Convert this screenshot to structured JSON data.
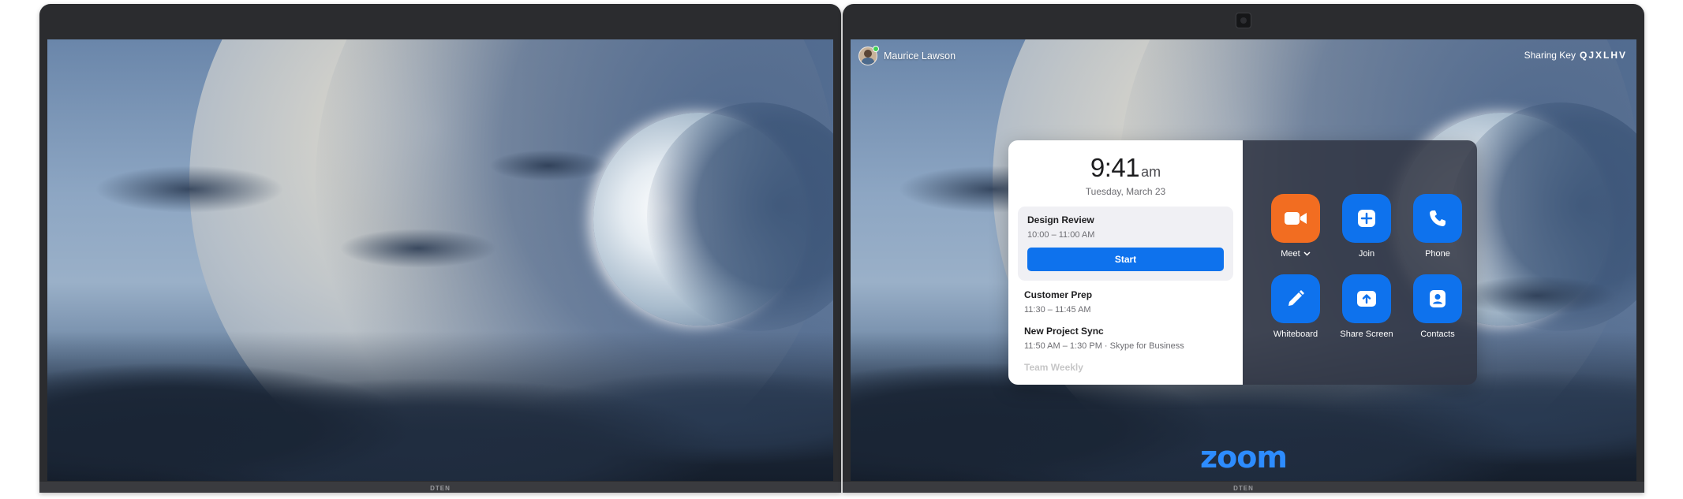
{
  "left_display": {
    "brand": "DTEN"
  },
  "right_display": {
    "brand": "DTEN",
    "user": {
      "name": "Maurice Lawson",
      "status_color": "#3fcf55"
    },
    "sharing": {
      "label": "Sharing Key",
      "key": "QJXLHV"
    },
    "clock": {
      "time": "9:41",
      "ampm": "am",
      "date": "Tuesday, March 23"
    },
    "meetings": [
      {
        "title": "Design Review",
        "time": "10:00 – 11:00 AM",
        "action": "Start"
      },
      {
        "title": "Customer Prep",
        "time": "11:30 – 11:45 AM"
      },
      {
        "title": "New Project Sync",
        "time": "11:50 AM – 1:30 PM · Skype for Business"
      },
      {
        "title": "Team Weekly"
      }
    ],
    "actions": [
      {
        "label": "Meet",
        "icon": "video-camera-icon",
        "color": "#f26d21"
      },
      {
        "label": "Join",
        "icon": "plus-icon",
        "color": "#0e72ed"
      },
      {
        "label": "Phone",
        "icon": "phone-icon",
        "color": "#0e72ed"
      },
      {
        "label": "Whiteboard",
        "icon": "pencil-icon",
        "color": "#0e72ed"
      },
      {
        "label": "Share Screen",
        "icon": "share-screen-icon",
        "color": "#0e72ed"
      },
      {
        "label": "Contacts",
        "icon": "contacts-icon",
        "color": "#0e72ed"
      }
    ],
    "logo": "zoom"
  }
}
